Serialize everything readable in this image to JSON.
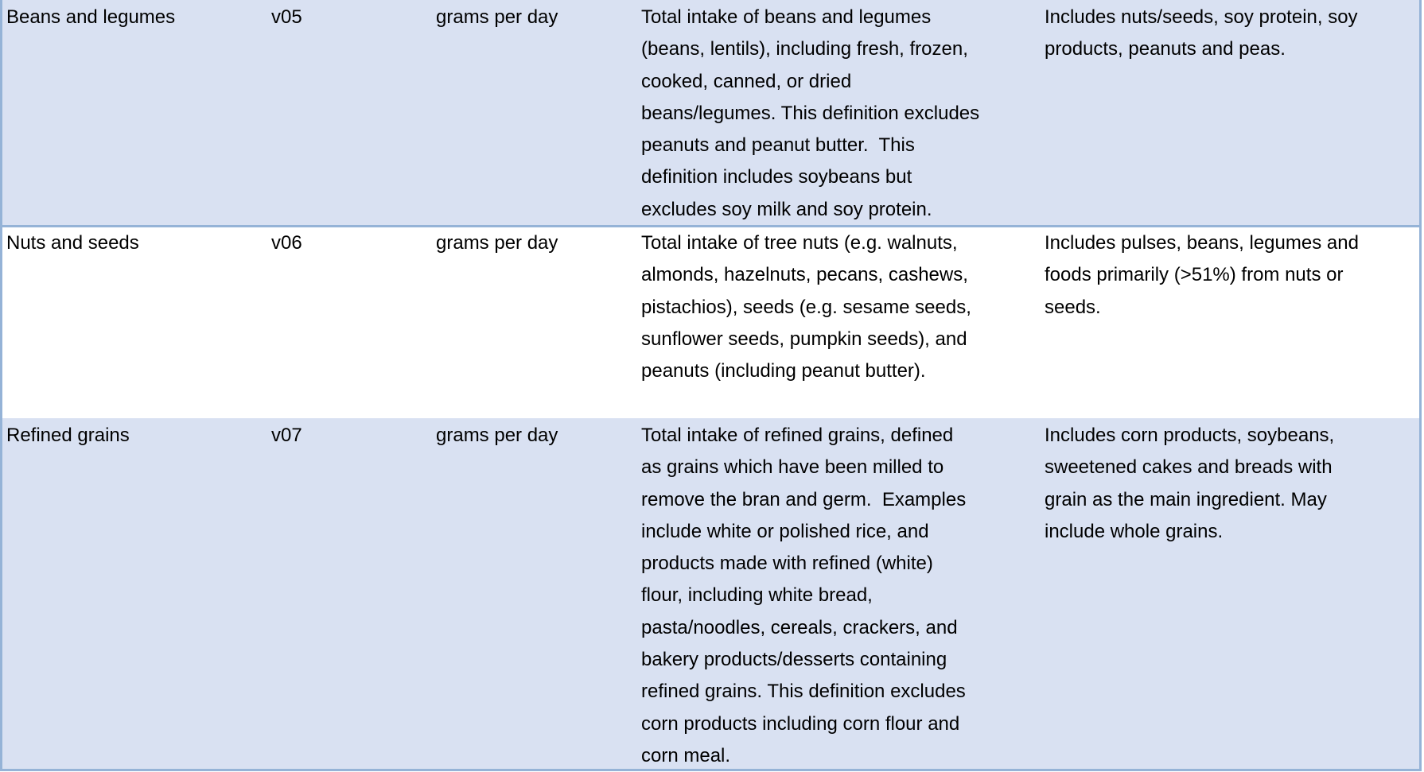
{
  "colors": {
    "row_shade": "#d9e1f2",
    "border": "#95b3d7"
  },
  "rows": [
    {
      "food": "Beans and legumes",
      "code": "v05",
      "unit": "grams per day",
      "definition": "Total intake of beans and legumes\n(beans, lentils), including fresh, frozen,\ncooked, canned, or dried\nbeans/legumes. This definition excludes\npeanuts and peanut butter.  This\ndefinition includes soybeans but\nexcludes soy milk and soy protein.",
      "notes": "Includes nuts/seeds, soy protein, soy\nproducts, peanuts and peas."
    },
    {
      "food": "Nuts and seeds",
      "code": "v06",
      "unit": "grams per day",
      "definition": "Total intake of tree nuts (e.g. walnuts,\nalmonds, hazelnuts, pecans, cashews,\npistachios), seeds (e.g. sesame seeds,\nsunflower seeds, pumpkin seeds), and\npeanuts (including peanut butter).",
      "notes": "Includes pulses, beans, legumes and\nfoods primarily (>51%) from nuts or\nseeds."
    },
    {
      "food": "Refined grains",
      "code": "v07",
      "unit": "grams per day",
      "definition": "Total intake of refined grains, defined\nas grains which have been milled to\nremove the bran and germ.  Examples\ninclude white or polished rice, and\nproducts made with refined (white)\nflour, including white bread,\npasta/noodles, cereals, crackers, and\nbakery products/desserts containing\nrefined grains. This definition excludes\ncorn products including corn flour and\ncorn meal.",
      "notes": "Includes corn products, soybeans,\nsweetened cakes and breads with\ngrain as the main ingredient. May\ninclude whole grains."
    }
  ]
}
